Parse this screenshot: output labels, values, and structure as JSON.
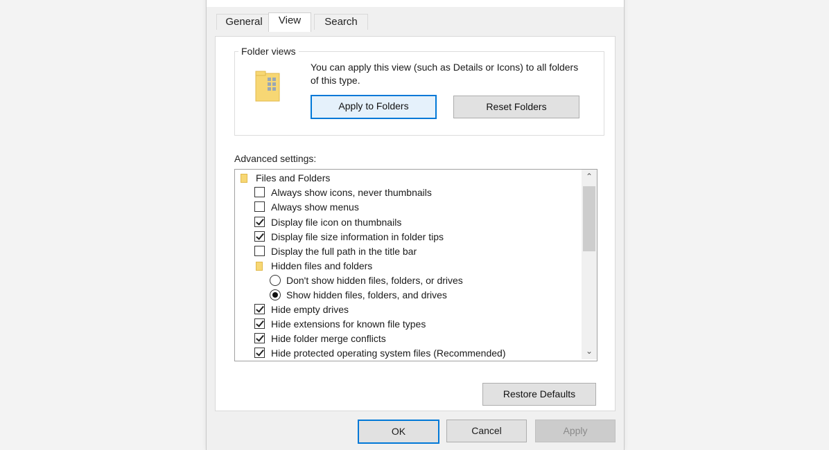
{
  "tabs": [
    {
      "label": "General"
    },
    {
      "label": "View"
    },
    {
      "label": "Search"
    }
  ],
  "folder_views": {
    "legend": "Folder views",
    "description": "You can apply this view (such as Details or Icons) to all folders of this type.",
    "apply_button": "Apply to Folders",
    "reset_button": "Reset Folders"
  },
  "advanced": {
    "label": "Advanced settings:",
    "items": [
      {
        "kind": "folder",
        "label": "Files and Folders"
      },
      {
        "kind": "checkbox",
        "checked": false,
        "label": "Always show icons, never thumbnails"
      },
      {
        "kind": "checkbox",
        "checked": false,
        "label": "Always show menus"
      },
      {
        "kind": "checkbox",
        "checked": true,
        "label": "Display file icon on thumbnails"
      },
      {
        "kind": "checkbox",
        "checked": true,
        "label": "Display file size information in folder tips"
      },
      {
        "kind": "checkbox",
        "checked": false,
        "label": "Display the full path in the title bar"
      },
      {
        "kind": "folder",
        "label": "Hidden files and folders"
      },
      {
        "kind": "radio",
        "checked": false,
        "label": "Don't show hidden files, folders, or drives"
      },
      {
        "kind": "radio",
        "checked": true,
        "label": "Show hidden files, folders, and drives"
      },
      {
        "kind": "checkbox",
        "checked": true,
        "label": "Hide empty drives"
      },
      {
        "kind": "checkbox",
        "checked": true,
        "label": "Hide extensions for known file types"
      },
      {
        "kind": "checkbox",
        "checked": true,
        "label": "Hide folder merge conflicts"
      },
      {
        "kind": "checkbox",
        "checked": true,
        "label": "Hide protected operating system files (Recommended)"
      }
    ]
  },
  "restore_button": "Restore Defaults",
  "footer": {
    "ok": "OK",
    "cancel": "Cancel",
    "apply": "Apply"
  },
  "colors": {
    "accent": "#0078d7",
    "folder": "#f7d774"
  }
}
